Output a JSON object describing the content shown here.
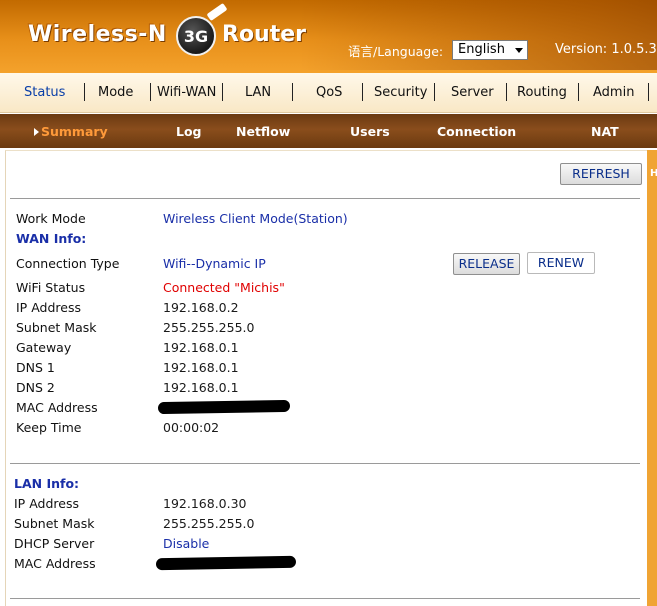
{
  "header": {
    "brand_left": "Wireless-N",
    "badge": "3G",
    "brand_right": "Router",
    "language_label": "语言/Language:",
    "language_value": "English",
    "version": "Version: 1.0.5.3"
  },
  "main_nav": {
    "items": [
      "Status",
      "Mode",
      "Wifi-WAN",
      "LAN",
      "QoS",
      "Security",
      "Server",
      "Routing",
      "Admin"
    ],
    "active": "Status"
  },
  "sub_nav": {
    "items": [
      "Summary",
      "Log",
      "Netflow",
      "Users",
      "Connection",
      "NAT"
    ],
    "active": "Summary"
  },
  "buttons": {
    "refresh": "REFRESH",
    "release": "RELEASE",
    "renew": "RENEW"
  },
  "work_mode": {
    "label": "Work Mode",
    "value": "Wireless Client Mode(Station)"
  },
  "wan": {
    "title": "WAN Info:",
    "rows": [
      {
        "label": "Connection Type",
        "value": "Wifi--Dynamic IP"
      },
      {
        "label": "WiFi Status",
        "value": "Connected \"Michis\""
      },
      {
        "label": "IP Address",
        "value": "192.168.0.2"
      },
      {
        "label": "Subnet Mask",
        "value": "255.255.255.0"
      },
      {
        "label": "Gateway",
        "value": "192.168.0.1"
      },
      {
        "label": "DNS 1",
        "value": "192.168.0.1"
      },
      {
        "label": "DNS 2",
        "value": "192.168.0.1"
      },
      {
        "label": "MAC Address",
        "value": ""
      },
      {
        "label": "Keep Time",
        "value": "00:00:02"
      }
    ]
  },
  "lan": {
    "title": "LAN Info:",
    "rows": [
      {
        "label": "IP Address",
        "value": "192.168.0.30"
      },
      {
        "label": "Subnet Mask",
        "value": "255.255.255.0"
      },
      {
        "label": "DHCP Server",
        "value": "Disable"
      },
      {
        "label": "MAC Address",
        "value": ""
      }
    ]
  },
  "colors": {
    "header_orange": "#e8901a",
    "subnav_brown": "#7a4418",
    "link_blue": "#1a2fa8",
    "status_red": "#e00000"
  }
}
